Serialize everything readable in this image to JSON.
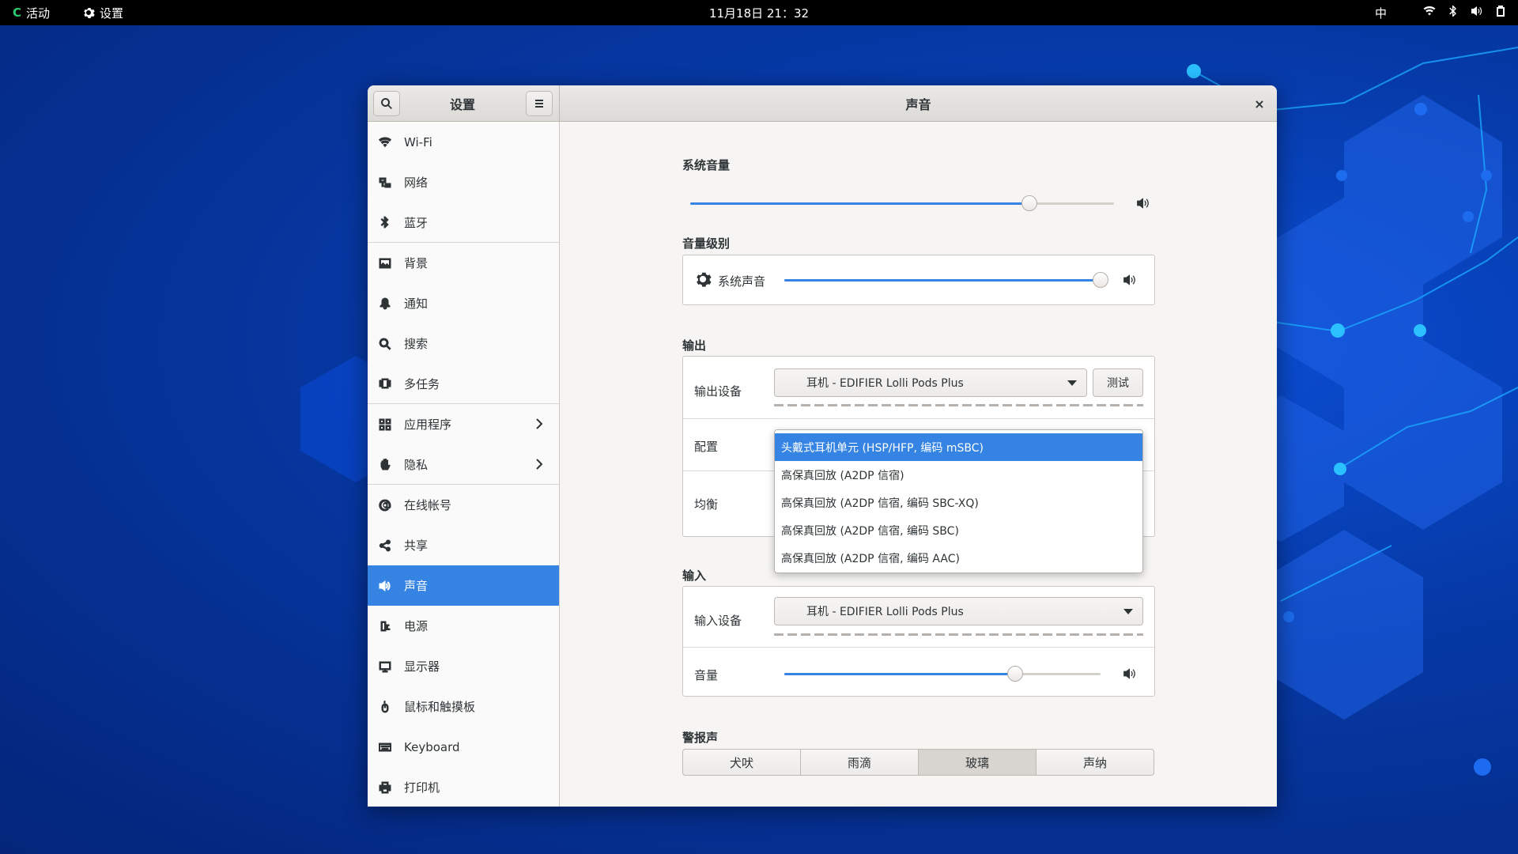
{
  "topbar": {
    "activities": "活动",
    "app_name": "设置",
    "clock": "11月18日 21：32",
    "input_method": "中"
  },
  "window": {
    "sidebar_title": "设置",
    "page_title": "声音",
    "close_glyph": "×"
  },
  "sidebar": {
    "items": [
      {
        "label": "Wi-Fi",
        "icon": "wifi-icon"
      },
      {
        "label": "网络",
        "icon": "network-icon"
      },
      {
        "label": "蓝牙",
        "icon": "bluetooth-icon"
      },
      {
        "label": "背景",
        "icon": "background-icon"
      },
      {
        "label": "通知",
        "icon": "bell-icon"
      },
      {
        "label": "搜索",
        "icon": "search-icon"
      },
      {
        "label": "多任务",
        "icon": "multitasking-icon"
      },
      {
        "label": "应用程序",
        "icon": "apps-icon"
      },
      {
        "label": "隐私",
        "icon": "hand-icon"
      },
      {
        "label": "在线帐号",
        "icon": "at-icon"
      },
      {
        "label": "共享",
        "icon": "share-icon"
      },
      {
        "label": "声音",
        "icon": "speaker-icon"
      },
      {
        "label": "电源",
        "icon": "power-icon"
      },
      {
        "label": "显示器",
        "icon": "display-icon"
      },
      {
        "label": "鼠标和触摸板",
        "icon": "mouse-icon"
      },
      {
        "label": "Keyboard",
        "icon": "keyboard-icon"
      },
      {
        "label": "打印机",
        "icon": "printer-icon"
      }
    ],
    "active_label": "声音"
  },
  "sound": {
    "system_volume": {
      "title": "系统音量",
      "level": 0.8
    },
    "volume_levels": {
      "title": "音量级别",
      "system_sounds_label": "系统声音",
      "level": 1.0
    },
    "output": {
      "title": "输出",
      "device_label": "输出设备",
      "device_value": "耳机 - EDIFIER Lolli Pods Plus",
      "test_button": "测试",
      "config_label": "配置",
      "balance_label": "均衡",
      "config_options": [
        "头戴式耳机单元 (HSP/HFP, 编码 mSBC)",
        "高保真回放 (A2DP 信宿)",
        "高保真回放 (A2DP 信宿, 编码 SBC-XQ)",
        "高保真回放 (A2DP 信宿, 编码 SBC)",
        "高保真回放 (A2DP 信宿, 编码 AAC)"
      ],
      "selected_option": 0
    },
    "input": {
      "title": "输入",
      "device_label": "输入设备",
      "device_value": "耳机 - EDIFIER Lolli Pods Plus",
      "volume_label": "音量",
      "level": 0.73
    },
    "alert": {
      "title": "警报声",
      "options": [
        "犬吠",
        "雨滴",
        "玻璃",
        "声纳"
      ],
      "selected": "玻璃"
    }
  },
  "colors": {
    "accent": "#3584e4",
    "topbar": "#000000",
    "wallpaper": "#0641b8"
  }
}
